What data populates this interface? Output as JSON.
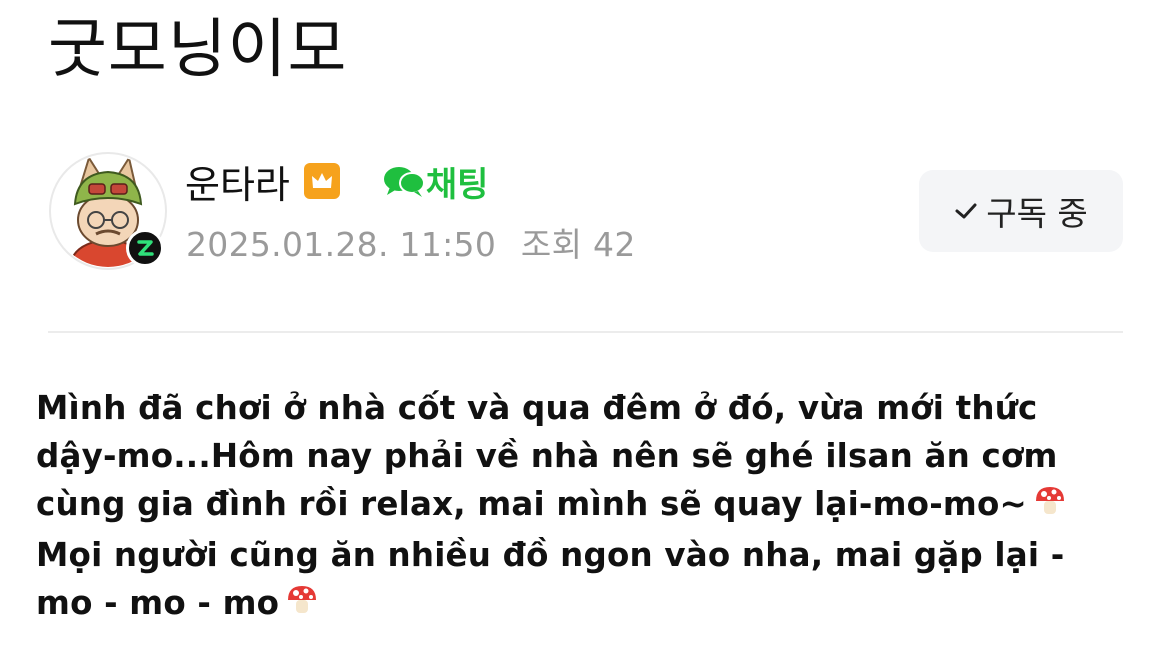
{
  "post": {
    "title": "굿모닝이모",
    "author": "운타라",
    "chat_label": "채팅",
    "date": "2025.01.28. 11:50",
    "views": "조회 42",
    "subscribe_label": "구독 중",
    "body_lines": [
      "Mình đã chơi ở nhà cốt và qua đêm ở đó, vừa mới thức",
      "dậy-mo...Hôm nay phải về nhà nên sẽ ghé ilsan ăn cơm",
      "cùng gia đình rồi relax, mai mình sẽ quay lại-mo-mo~",
      "Mọi người cũng ăn nhiều đồ ngon vào nha, mai gặp lại -",
      "mo - mo - mo"
    ]
  },
  "icons": {
    "crown": "crown-badge-icon",
    "chat": "chat-bubbles-icon",
    "check": "check-icon",
    "mushroom": "mushroom-emoji-icon",
    "level_badge": "z-level-badge-icon"
  },
  "colors": {
    "chat_green": "#1fbf3f",
    "crown_orange": "#f6a21c",
    "meta_gray": "#9a9a9a",
    "button_bg": "#f4f5f7"
  }
}
